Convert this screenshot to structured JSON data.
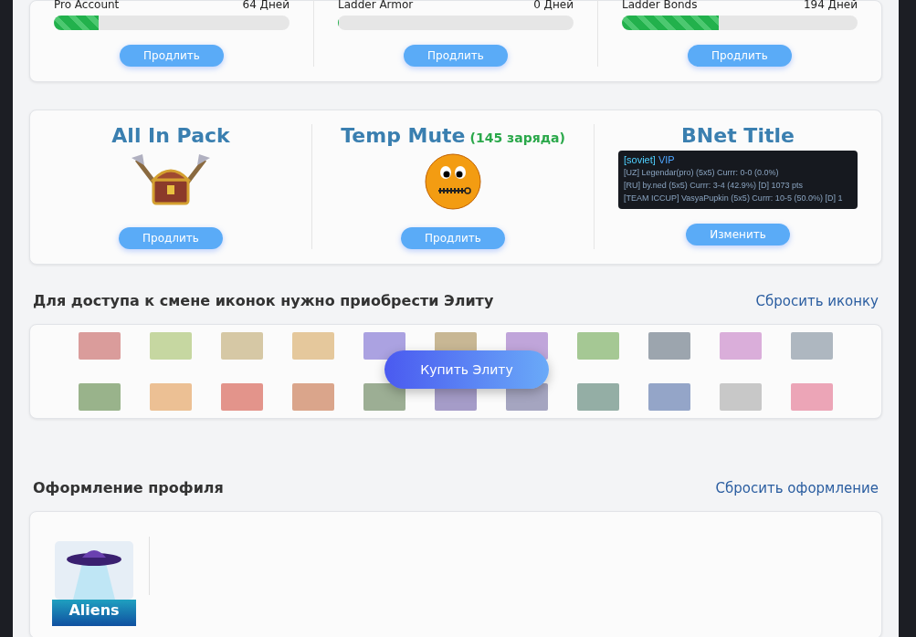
{
  "subscriptions": [
    {
      "name": "Pro Account",
      "days": "64 Дней",
      "level": 0.19,
      "button": "Продлить"
    },
    {
      "name": "Ladder Armor",
      "days": "0 Дней",
      "level": 0,
      "button": "Продлить"
    },
    {
      "name": "Ladder Bonds",
      "days": "194 Дней",
      "level": 0.41,
      "button": "Продлить"
    }
  ],
  "items": [
    {
      "kind": "pack",
      "title": "All In Pack",
      "button": "Продлить"
    },
    {
      "kind": "mute",
      "title": "Temp Mute",
      "note": "(145 заряда)",
      "button": "Продлить"
    },
    {
      "kind": "title",
      "title": "BNet Title",
      "preview": {
        "tag": "[soviet]",
        "rank": "VIP",
        "lines": [
          "[UZ] Legendar(pro) (5x5) Currr: 0-0 (0.0%)",
          "[RU] by.ned (5x5) Currr: 3-4 (42.9%) [D] 1073 pts",
          "[TEAM ICCUP] VasyaPupkin (5x5) Currr: 10-5 (50.0%) [D] 1"
        ]
      },
      "button": "Изменить"
    }
  ],
  "icons_section": {
    "heading": "Для доступа к смене иконок нужно приобрести Элиту",
    "reset": "Сбросить иконку",
    "buy": "Купить Элиту"
  },
  "profile_section": {
    "heading": "Оформление профиля",
    "reset": "Сбросить оформление",
    "theme": "Aliens"
  }
}
